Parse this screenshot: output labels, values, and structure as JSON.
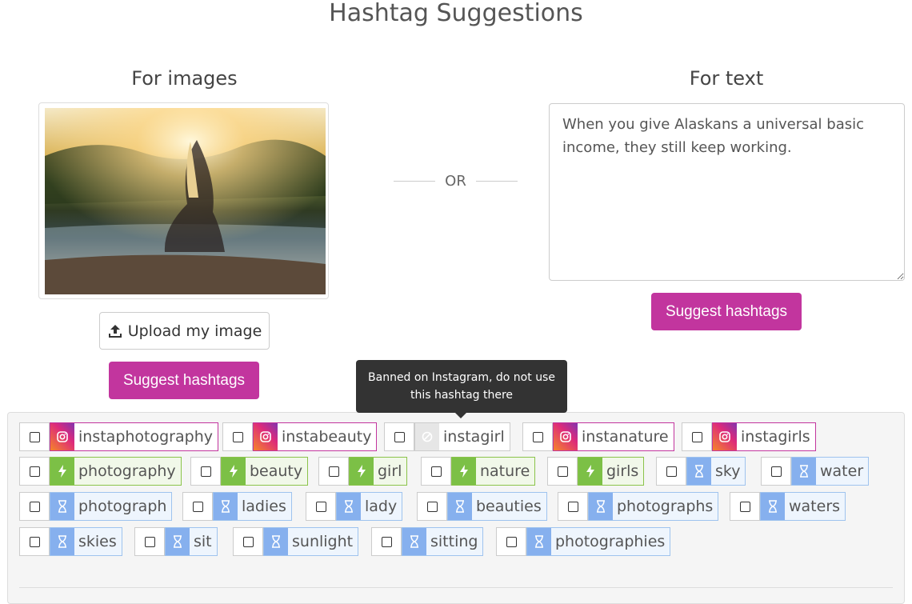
{
  "header": {
    "title": "Hashtag Suggestions"
  },
  "images_section": {
    "title": "For images",
    "upload_label": "Upload my image",
    "suggest_label": "Suggest hashtags"
  },
  "separator": {
    "label": "OR"
  },
  "text_section": {
    "title": "For text",
    "input_value": "When you give Alaskans a universal basic income, they still keep working.",
    "suggest_label": "Suggest hashtags"
  },
  "tooltip": {
    "text": "Banned on Instagram, do not use this hashtag there"
  },
  "tags": [
    {
      "label": "instaphotography",
      "type": "instagram"
    },
    {
      "label": "instabeauty",
      "type": "instagram"
    },
    {
      "label": "instagirl",
      "type": "banned"
    },
    {
      "label": "instanature",
      "type": "instagram"
    },
    {
      "label": "instagirls",
      "type": "instagram"
    },
    {
      "label": "photography",
      "type": "popular"
    },
    {
      "label": "beauty",
      "type": "popular"
    },
    {
      "label": "girl",
      "type": "popular"
    },
    {
      "label": "nature",
      "type": "popular"
    },
    {
      "label": "girls",
      "type": "popular"
    },
    {
      "label": "sky",
      "type": "pending"
    },
    {
      "label": "water",
      "type": "pending"
    },
    {
      "label": "photograph",
      "type": "pending"
    },
    {
      "label": "ladies",
      "type": "pending"
    },
    {
      "label": "lady",
      "type": "pending"
    },
    {
      "label": "beauties",
      "type": "pending"
    },
    {
      "label": "photographs",
      "type": "pending"
    },
    {
      "label": "waters",
      "type": "pending"
    },
    {
      "label": "skies",
      "type": "pending"
    },
    {
      "label": "sit",
      "type": "pending"
    },
    {
      "label": "sunlight",
      "type": "pending"
    },
    {
      "label": "sitting",
      "type": "pending"
    },
    {
      "label": "photographies",
      "type": "pending"
    }
  ],
  "colors": {
    "accent": "#c2359e",
    "popular": "#7cc046",
    "pending": "#86b0ee",
    "banned": "#e6e6e6"
  }
}
